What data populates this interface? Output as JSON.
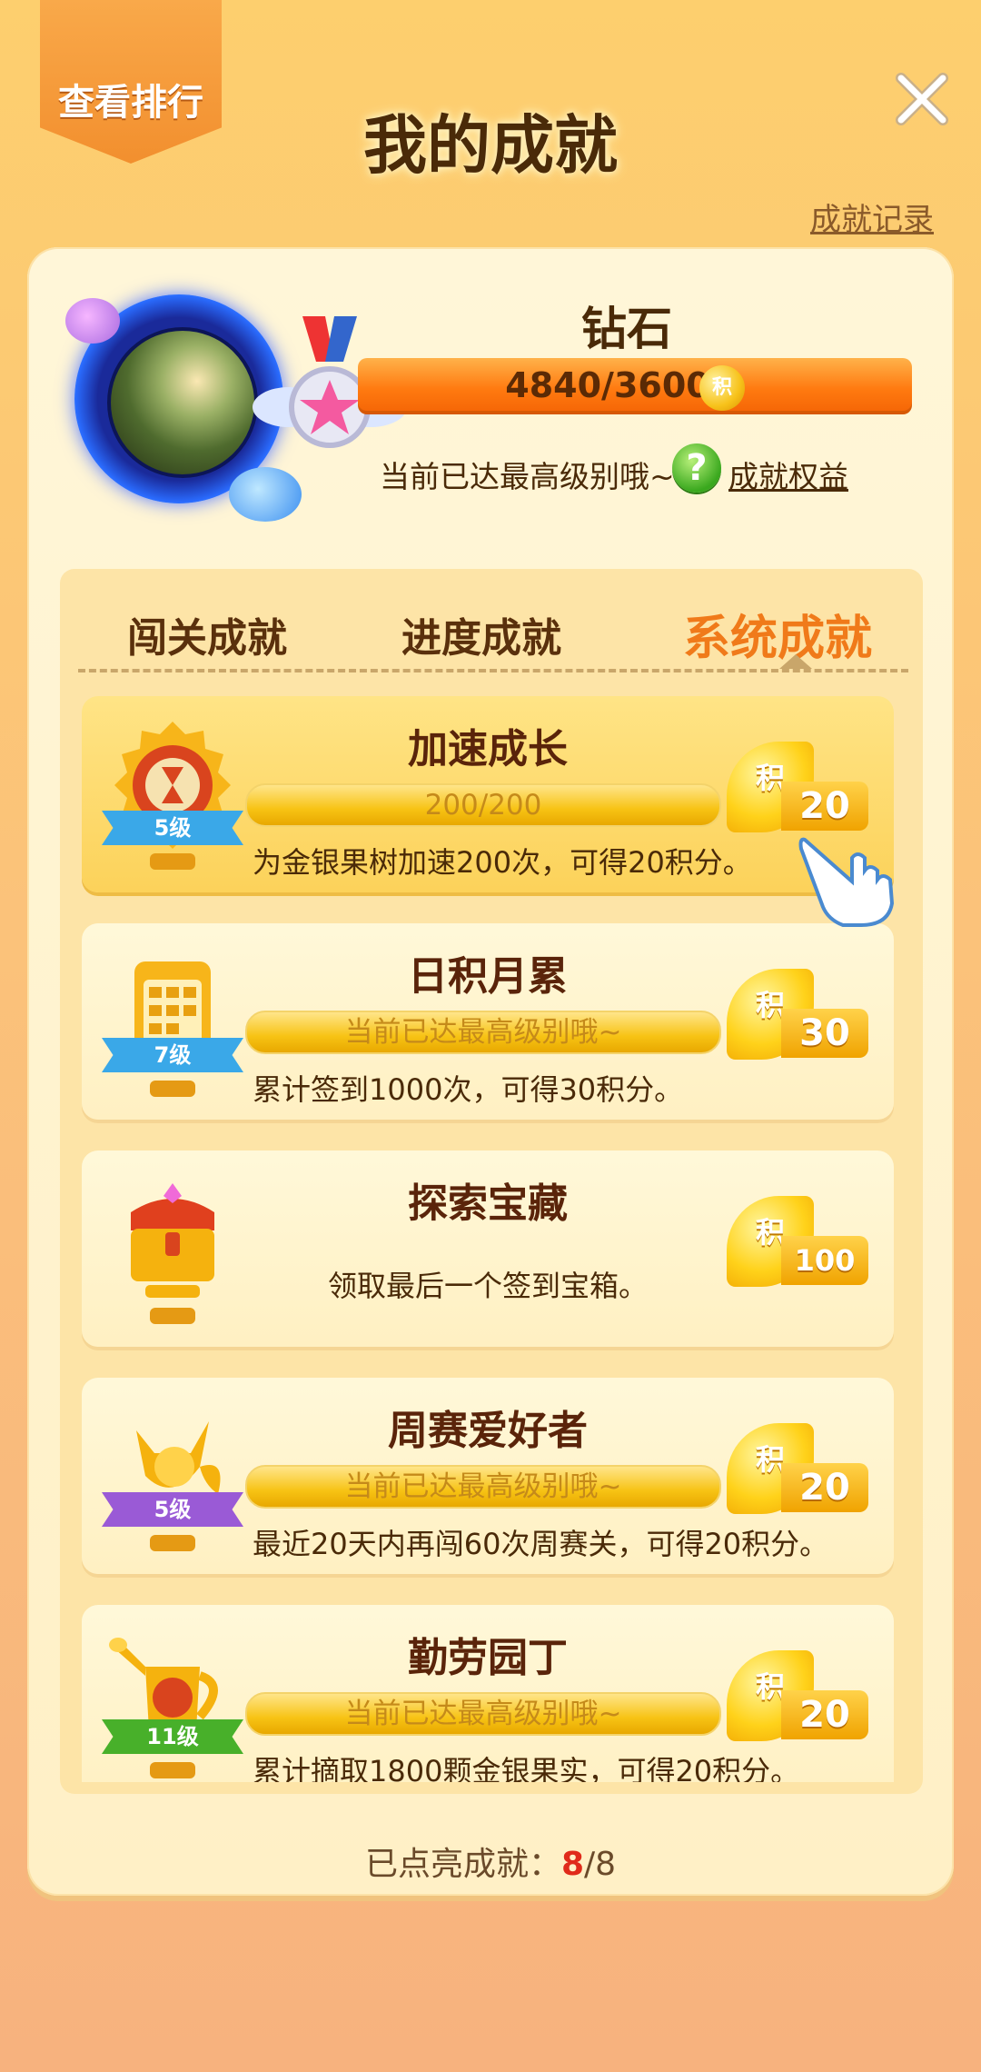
{
  "header": {
    "ranking_tab": "查看排行",
    "title": "我的成就",
    "record_link": "成就记录"
  },
  "profile": {
    "rank_name": "钻石",
    "score": "4840/3600",
    "coin_label": "积",
    "max_text": "当前已达最高级别哦~",
    "help_icon": "?",
    "benefits_link": "成就权益"
  },
  "tabs": [
    {
      "label": "闯关成就",
      "active": false
    },
    {
      "label": "进度成就",
      "active": false
    },
    {
      "label": "系统成就",
      "active": true
    }
  ],
  "achievements": [
    {
      "title": "加速成长",
      "level": "5级",
      "progress": "200/200",
      "desc": "为金银果树加速200次，可得20积分。",
      "reward_label": "积",
      "reward": "20",
      "badge": "hourglass-icon",
      "level_color": "#3aa8e8"
    },
    {
      "title": "日积月累",
      "level": "7级",
      "progress": "当前已达最高级别哦~",
      "desc": "累计签到1000次，可得30积分。",
      "reward_label": "积",
      "reward": "30",
      "badge": "calendar-icon",
      "level_color": "#3aa8e8"
    },
    {
      "title": "探索宝藏",
      "level": "",
      "progress": "",
      "desc": "领取最后一个签到宝箱。",
      "reward_label": "积",
      "reward": "100",
      "badge": "treasure-chest-icon",
      "level_color": ""
    },
    {
      "title": "周赛爱好者",
      "level": "5级",
      "progress": "当前已达最高级别哦~",
      "desc": "最近20天内再闯60次周赛关，可得20积分。",
      "reward_label": "积",
      "reward": "20",
      "badge": "fox-trophy-icon",
      "level_color": "#9a5ad6"
    },
    {
      "title": "勤劳园丁",
      "level": "11级",
      "progress": "当前已达最高级别哦~",
      "desc": "累计摘取1800颗金银果实，可得20积分。",
      "reward_label": "积",
      "reward": "20",
      "badge": "watering-can-icon",
      "level_color": "#48b02a"
    }
  ],
  "footer": {
    "label": "已点亮成就：",
    "lit": "8",
    "total": "/8"
  },
  "colors": {
    "accent": "#f07a1a",
    "score_bar": "#ff7a10",
    "lit_count": "#e02a1a"
  }
}
